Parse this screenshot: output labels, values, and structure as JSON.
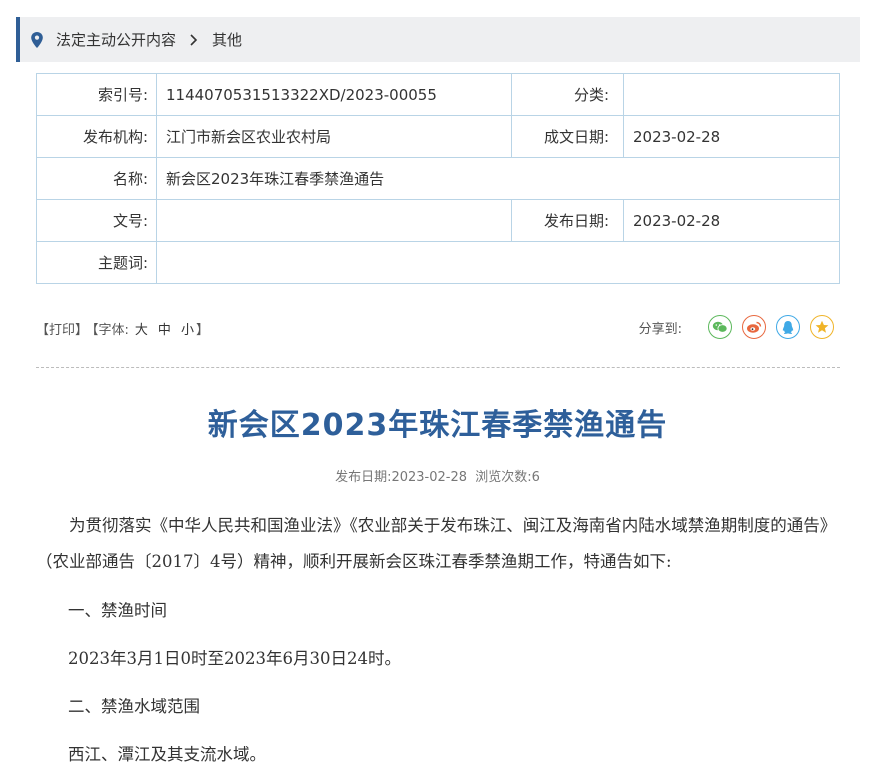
{
  "breadcrumb": {
    "level1": "法定主动公开内容",
    "level2": "其他"
  },
  "meta": {
    "index_label": "索引号:",
    "index_value": "1144070531513322XD/2023-00055",
    "category_label": "分类:",
    "category_value": "",
    "publisher_label": "发布机构:",
    "publisher_value": "江门市新会区农业农村局",
    "created_label": "成文日期:",
    "created_value": "2023-02-28",
    "name_label": "名称:",
    "name_value": "新会区2023年珠江春季禁渔通告",
    "docno_label": "文号:",
    "docno_value": "",
    "pubdate_label": "发布日期:",
    "pubdate_value": "2023-02-28",
    "keywords_label": "主题词:",
    "keywords_value": ""
  },
  "tools": {
    "print": "【打印】",
    "font_prefix": "【字体:",
    "font_large": "大",
    "font_medium": "中",
    "font_small": "小",
    "font_suffix": "】",
    "share_label": "分享到:"
  },
  "share_icons": [
    {
      "name": "wechat-icon",
      "color": "#5cb85c"
    },
    {
      "name": "weibo-icon",
      "color": "#e8683f"
    },
    {
      "name": "qq-icon",
      "color": "#3fa9e6"
    },
    {
      "name": "qzone-icon",
      "color": "#f0b429"
    }
  ],
  "article": {
    "title": "新会区2023年珠江春季禁渔通告",
    "pubinfo": "发布日期:2023-02-28  浏览次数:6",
    "paragraphs": [
      "为贯彻落实《中华人民共和国渔业法》《农业部关于发布珠江、闽江及海南省内陆水域禁渔期制度的通告》（农业部通告〔2017〕4号）精神，顺利开展新会区珠江春季禁渔期工作，特通告如下:",
      "一、禁渔时间",
      "2023年3月1日0时至2023年6月30日24时。",
      "二、禁渔水域范围",
      "西江、潭江及其支流水域。"
    ]
  }
}
